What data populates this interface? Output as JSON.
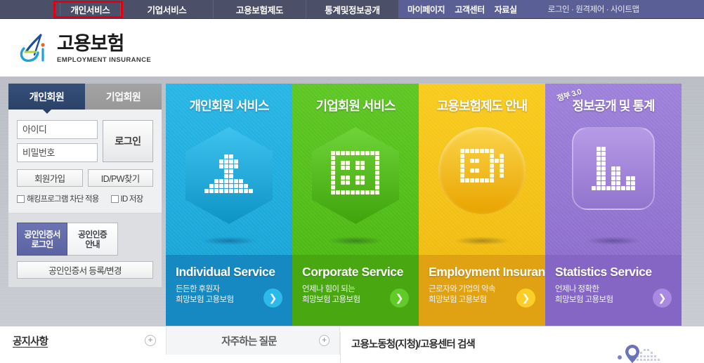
{
  "topnav": {
    "items": [
      {
        "label": "개인서비스",
        "highlighted": true
      },
      {
        "label": "기업서비스",
        "highlighted": false
      },
      {
        "label": "고용보험제도",
        "highlighted": false
      },
      {
        "label": "통계및정보공개",
        "highlighted": false
      }
    ],
    "utility": [
      {
        "label": "마이페이지"
      },
      {
        "label": "고객센터"
      },
      {
        "label": "자료실"
      }
    ],
    "links": "로그인 · 원격제어 · 사이트맵",
    "highlight_color": "#e2000f",
    "bar_color": "#4b4f68",
    "right_color": "#5a6096"
  },
  "header": {
    "logo_ko": "고용보험",
    "logo_en": "EMPLOYMENT INSURANCE"
  },
  "login": {
    "tabs": [
      {
        "label": "개인회원",
        "active": true
      },
      {
        "label": "기업회원",
        "active": false
      }
    ],
    "id_placeholder": "아이디",
    "pw_placeholder": "비밀번호",
    "login_button": "로그인",
    "join_button": "회원가입",
    "find_button": "ID/PW찾기",
    "check_hacking": "해킹프로그램 차단 적용",
    "check_saveid": "ID 저장",
    "cert_login": "공인인증서\n로그인",
    "cert_login_line1": "공인인증서",
    "cert_login_line2": "로그인",
    "cert_guide_line1": "공인인증",
    "cert_guide_line2": "안내",
    "cert_register": "공인인증서 등록/변경"
  },
  "panels": [
    {
      "title": "개인회원 서비스",
      "en": "Individual Service",
      "desc_line1": "든든한 후원자",
      "desc_line2": "희망보험 고용보험",
      "color": "#1eaee0",
      "icon": "person-pixel-icon",
      "shape": "hexagon"
    },
    {
      "title": "기업회원 서비스",
      "en": "Corporate Service",
      "desc_line1": "언제나 힘이 되는",
      "desc_line2": "희망보험 고용보험",
      "color": "#55c11a",
      "icon": "building-pixel-icon",
      "shape": "hexagon"
    },
    {
      "title": "고용보험제도 안내",
      "en": "Employment Insurance",
      "desc_line1": "근로자와 기업의 약속",
      "desc_line2": "희망보험 고용보험",
      "color": "#f5c518",
      "icon": "document-pixel-icon",
      "shape": "circle"
    },
    {
      "title": "정보공개 및 통계",
      "badge": "정부 3.0",
      "en": "Statistics Service",
      "desc_line1": "언제나 정확한",
      "desc_line2": "희망보험 고용보험",
      "color": "#9778d6",
      "icon": "bar-chart-pixel-icon",
      "shape": "rounded"
    }
  ],
  "bottom": {
    "notice_tab": "공지사항",
    "faq_tab": "자주하는 질문",
    "plus_label": "+",
    "search_title": "고용노동청(지청)/고용센터 검색",
    "arrow_glyph": "❯"
  }
}
